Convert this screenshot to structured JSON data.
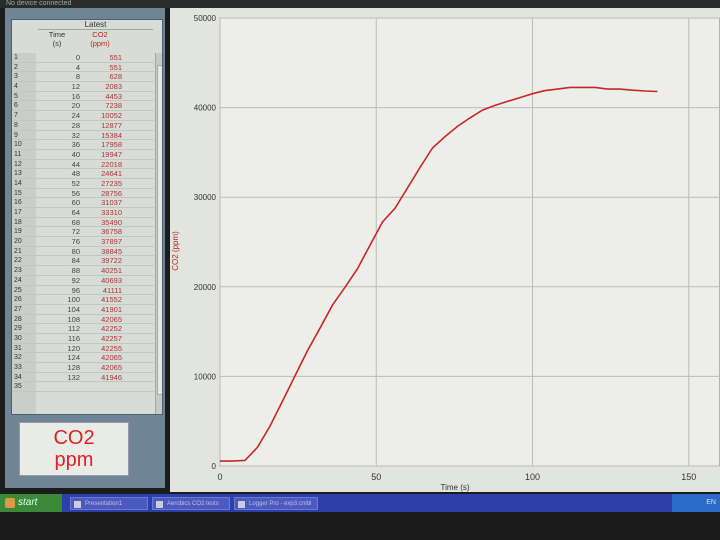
{
  "window": {
    "title": "No device connected"
  },
  "table": {
    "title": "Latest",
    "col_time": "Time\n(s)",
    "col_co2": "CO2\n(ppm)",
    "rows": [
      {
        "i": "1",
        "t": "0",
        "c": "551"
      },
      {
        "i": "2",
        "t": "4",
        "c": "551"
      },
      {
        "i": "3",
        "t": "8",
        "c": "628"
      },
      {
        "i": "4",
        "t": "12",
        "c": "2083"
      },
      {
        "i": "5",
        "t": "16",
        "c": "4453"
      },
      {
        "i": "6",
        "t": "20",
        "c": "7238"
      },
      {
        "i": "7",
        "t": "24",
        "c": "10052"
      },
      {
        "i": "8",
        "t": "28",
        "c": "12877"
      },
      {
        "i": "9",
        "t": "32",
        "c": "15384"
      },
      {
        "i": "10",
        "t": "36",
        "c": "17958"
      },
      {
        "i": "11",
        "t": "40",
        "c": "19947"
      },
      {
        "i": "12",
        "t": "44",
        "c": "22018"
      },
      {
        "i": "13",
        "t": "48",
        "c": "24641"
      },
      {
        "i": "14",
        "t": "52",
        "c": "27235"
      },
      {
        "i": "15",
        "t": "56",
        "c": "28756"
      },
      {
        "i": "16",
        "t": "60",
        "c": "31037"
      },
      {
        "i": "17",
        "t": "64",
        "c": "33310"
      },
      {
        "i": "18",
        "t": "68",
        "c": "35490"
      },
      {
        "i": "19",
        "t": "72",
        "c": "36758"
      },
      {
        "i": "20",
        "t": "76",
        "c": "37897"
      },
      {
        "i": "21",
        "t": "80",
        "c": "38845"
      },
      {
        "i": "22",
        "t": "84",
        "c": "39722"
      },
      {
        "i": "23",
        "t": "88",
        "c": "40251"
      },
      {
        "i": "24",
        "t": "92",
        "c": "40693"
      },
      {
        "i": "25",
        "t": "96",
        "c": "41111"
      },
      {
        "i": "26",
        "t": "100",
        "c": "41552"
      },
      {
        "i": "27",
        "t": "104",
        "c": "41901"
      },
      {
        "i": "28",
        "t": "108",
        "c": "42065"
      },
      {
        "i": "29",
        "t": "112",
        "c": "42252"
      },
      {
        "i": "30",
        "t": "116",
        "c": "42257"
      },
      {
        "i": "31",
        "t": "120",
        "c": "42255"
      },
      {
        "i": "32",
        "t": "124",
        "c": "42065"
      },
      {
        "i": "33",
        "t": "128",
        "c": "42065"
      },
      {
        "i": "34",
        "t": "132",
        "c": "41946"
      },
      {
        "i": "35",
        "t": "",
        "c": ""
      }
    ]
  },
  "meter": {
    "label": "CO2",
    "unit": "ppm"
  },
  "chart_data": {
    "type": "line",
    "title": "",
    "xlabel": "Time (s)",
    "ylabel": "CO2 (ppm)",
    "xlim": [
      0,
      160
    ],
    "ylim": [
      0,
      50000
    ],
    "x_ticks": [
      0,
      50,
      100,
      150
    ],
    "y_ticks": [
      0,
      10000,
      20000,
      30000,
      40000,
      50000
    ],
    "x_tick_labels": [
      "0",
      "50",
      "100",
      "150"
    ],
    "y_tick_labels": [
      "0",
      "10000",
      "20000",
      "30000",
      "40000",
      "50000"
    ],
    "grid": true,
    "series": [
      {
        "color": "#c62828",
        "x": [
          0,
          4,
          8,
          12,
          16,
          20,
          24,
          28,
          32,
          36,
          40,
          44,
          48,
          52,
          56,
          60,
          64,
          68,
          72,
          76,
          80,
          84,
          88,
          92,
          96,
          100,
          104,
          108,
          112,
          116,
          120,
          124,
          128,
          132,
          136,
          140
        ],
        "y": [
          551,
          551,
          628,
          2083,
          4453,
          7238,
          10052,
          12877,
          15384,
          17958,
          19947,
          22018,
          24641,
          27235,
          28756,
          31037,
          33310,
          35490,
          36758,
          37897,
          38845,
          39722,
          40251,
          40693,
          41111,
          41552,
          41901,
          42065,
          42252,
          42257,
          42255,
          42065,
          42065,
          41946,
          41850,
          41800
        ]
      }
    ]
  },
  "taskbar": {
    "start_label": "start",
    "tasks": [
      "Presentation1",
      "Aerobics CO2 tests",
      "Logger Pro - exp3.cmbl"
    ],
    "tray_text": "EN"
  }
}
